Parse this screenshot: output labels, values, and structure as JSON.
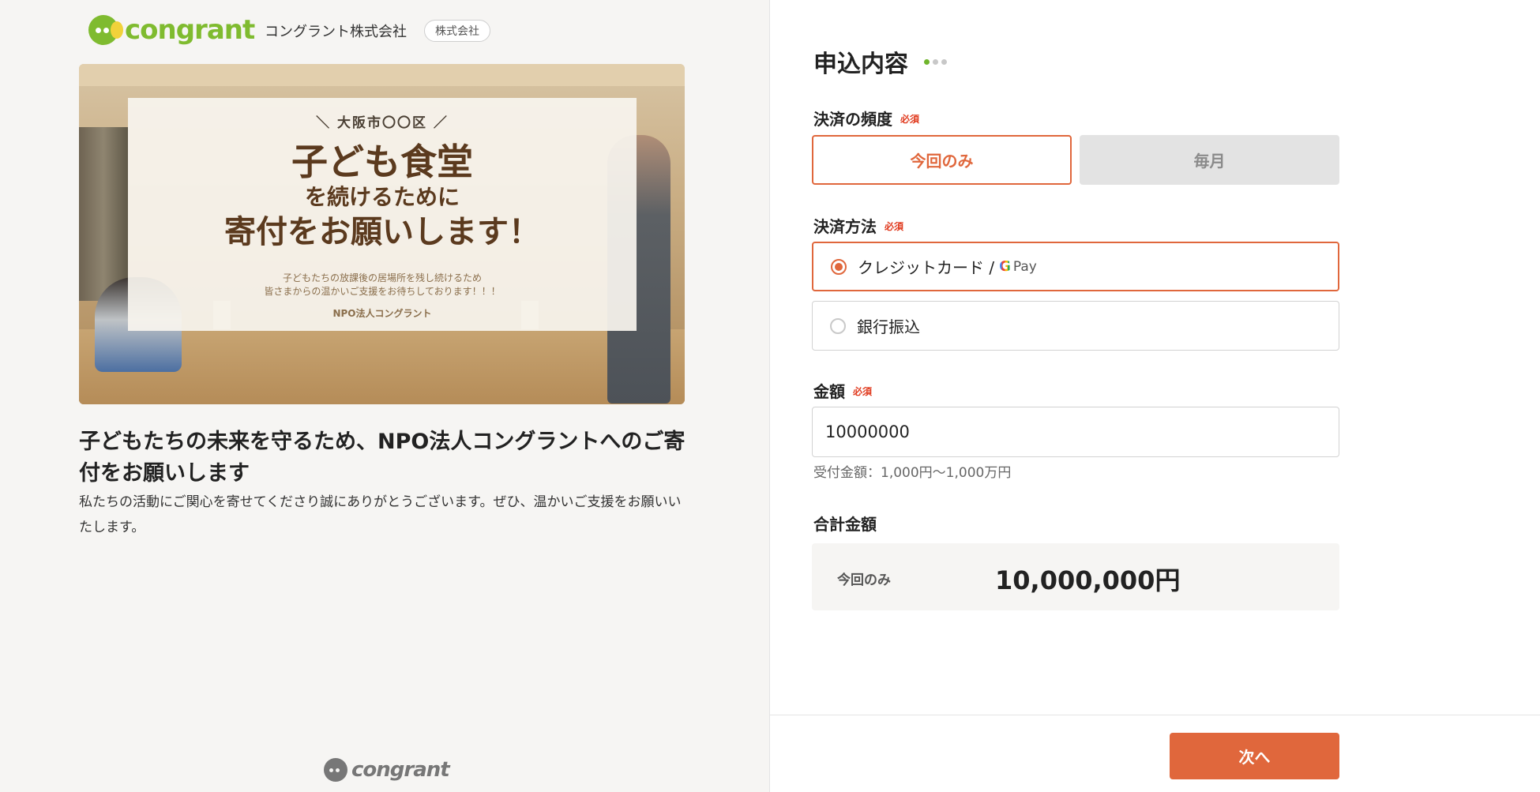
{
  "header": {
    "logo_text": "congrant",
    "org_name": "コングラント株式会社",
    "org_badge": "株式会社"
  },
  "hero": {
    "location": "＼ 大阪市〇〇区 ／",
    "line1": "子ども食堂",
    "line2": "を続けるために",
    "line3": "寄付をお願いします！",
    "sub": "子どもたちの放課後の居場所を残し続けるため\n皆さまからの温かいご支援をお待ちしております！！！",
    "org": "NPO法人コングラント"
  },
  "campaign": {
    "title": "子どもたちの未来を守るため、NPO法人コングラントへのご寄付をお願いします",
    "description": "私たちの活動にご関心を寄せてくださり誠にありがとうございます。ぜひ、温かいご支援をお願いいたします。"
  },
  "footer": {
    "logo_text": "congrant"
  },
  "form": {
    "title": "申込内容",
    "frequency": {
      "label": "決済の頻度",
      "required": "必須",
      "options": [
        "今回のみ",
        "毎月"
      ],
      "selected": "今回のみ"
    },
    "payment": {
      "label": "決済方法",
      "required": "必須",
      "card_label": "クレジットカード /",
      "gpay_g": "G",
      "gpay_text": "Pay",
      "bank_label": "銀行振込",
      "selected": "card"
    },
    "amount": {
      "label": "金額",
      "required": "必須",
      "value": "10000000",
      "note": "受付金額：1,000円〜1,000万円"
    },
    "total": {
      "label": "合計金額",
      "type": "今回のみ",
      "value": "10,000,000円"
    },
    "next_label": "次へ"
  },
  "colors": {
    "accent": "#e0673c",
    "brand_green": "#7fbb2f",
    "required_red": "#e03a1e"
  }
}
